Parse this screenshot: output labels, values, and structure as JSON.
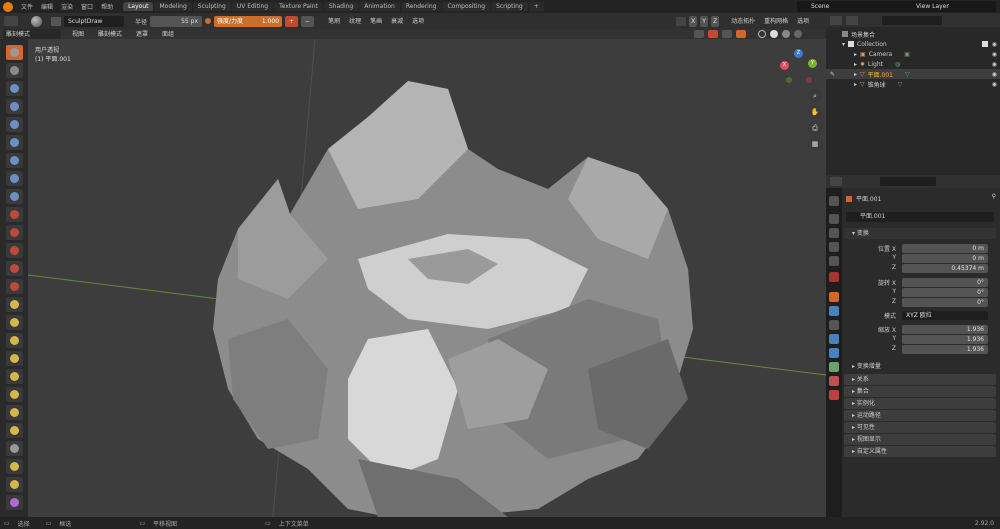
{
  "menu": [
    "文件",
    "编辑",
    "渲染",
    "窗口",
    "帮助"
  ],
  "workspaces": [
    {
      "label": "Layout",
      "active": true
    },
    {
      "label": "Modeling"
    },
    {
      "label": "Sculpting"
    },
    {
      "label": "UV Editing"
    },
    {
      "label": "Texture Paint"
    },
    {
      "label": "Shading"
    },
    {
      "label": "Animation"
    },
    {
      "label": "Rendering"
    },
    {
      "label": "Compositing"
    },
    {
      "label": "Scripting"
    }
  ],
  "add_workspace": "+",
  "scene": "Scene",
  "view_layer": "View Layer",
  "tool_header": {
    "brush_name": "SculptDraw",
    "radius_label": "半径",
    "radius_value": "55 px",
    "strength_label": "强度/力度",
    "strength_value": "1.000",
    "plus": "+",
    "minus": "−",
    "dropdowns": [
      "笔刷",
      "纹理",
      "笔画",
      "衰减",
      "选项"
    ],
    "axes": [
      "X",
      "Y",
      "Z"
    ],
    "dyntopo": "动态拓扑",
    "remesh": "重构网格",
    "options": "选项"
  },
  "view_header": {
    "mode": "雕刻模式",
    "menus": [
      "视图",
      "雕刻模式",
      "遮罩",
      "面组"
    ]
  },
  "viewport": {
    "view_name": "用户透视",
    "object_name": "(1) 平面.001"
  },
  "gizmo": {
    "x": "X",
    "y": "Y",
    "z": "Z"
  },
  "outliner": {
    "root": "场景集合",
    "collection": "Collection",
    "items": [
      {
        "label": "Camera",
        "icon": "camera-icon"
      },
      {
        "label": "Light",
        "icon": "light-icon"
      },
      {
        "label": "平面.001",
        "icon": "mesh-icon",
        "selected": true
      },
      {
        "label": "锥角球",
        "icon": "mesh-icon"
      }
    ]
  },
  "properties": {
    "object_name": "平面.001",
    "object_field": "平面.001",
    "transform_section": "变换",
    "location": {
      "label_x": "位置 X",
      "label_y": "Y",
      "label_z": "Z",
      "x": "0 m",
      "y": "0 m",
      "z": "0.45374 m"
    },
    "rotation": {
      "label_x": "旋转 X",
      "label_y": "Y",
      "label_z": "Z",
      "x": "0°",
      "y": "0°",
      "z": "0°"
    },
    "mode_label": "模式",
    "mode_value": "XYZ 欧拉",
    "scale": {
      "label_x": "缩放 X",
      "label_y": "Y",
      "label_z": "Z",
      "x": "1.936",
      "y": "1.936",
      "z": "1.936"
    },
    "delta": "变换增量",
    "sections": [
      "关系",
      "集合",
      "实例化",
      "运动路径",
      "可见性",
      "视图显示",
      "自定义属性"
    ]
  },
  "status": {
    "select": "选择",
    "box_select": "框选",
    "pan": "平移视图",
    "context_menu": "上下文菜单",
    "version": "2.92.0"
  },
  "colors": {
    "accent": "#d3672b",
    "axis_x": "#e84a5f",
    "axis_y": "#80b52f",
    "axis_z": "#3d7bd1"
  }
}
